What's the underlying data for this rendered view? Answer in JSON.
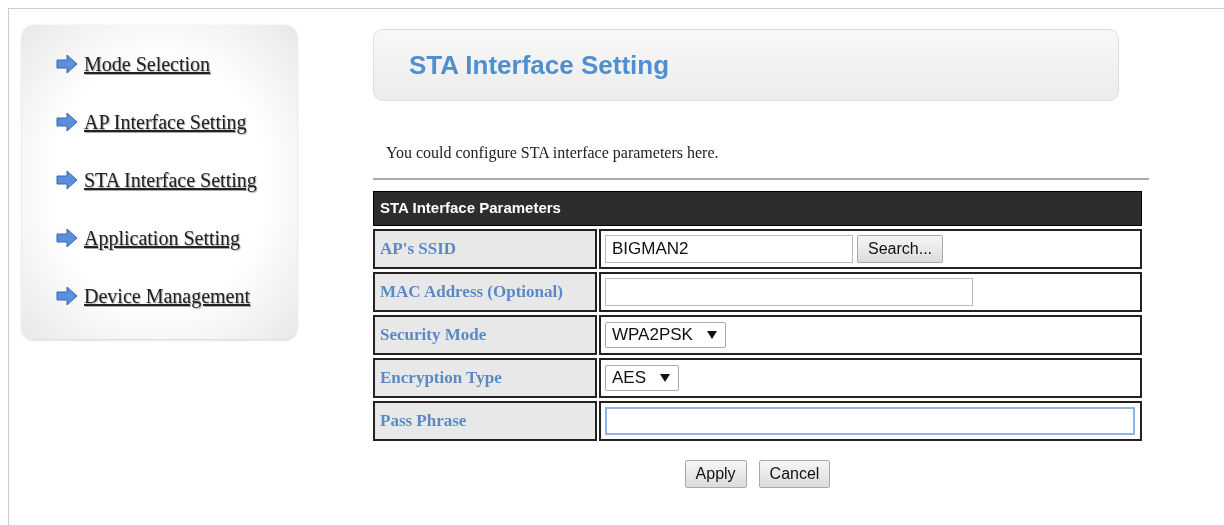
{
  "sidebar": {
    "items": [
      {
        "label": "Mode Selection"
      },
      {
        "label": "AP Interface Setting"
      },
      {
        "label": "STA Interface Setting"
      },
      {
        "label": "Application Setting"
      },
      {
        "label": "Device Management"
      }
    ]
  },
  "header": {
    "title": "STA Interface Setting"
  },
  "description": "You could configure STA interface parameters here.",
  "table": {
    "title": "STA Interface Parameters",
    "rows": [
      {
        "label": "AP's SSID",
        "kind": "text",
        "value": "BIGMAN2",
        "button": "Search...",
        "focused": false
      },
      {
        "label": "MAC Address (Optional)",
        "kind": "text",
        "focused": false
      },
      {
        "label": "Security Mode",
        "kind": "select",
        "value": "WPA2PSK",
        "focused": false
      },
      {
        "label": "Encryption Type",
        "kind": "select",
        "value": "AES",
        "focused": false
      },
      {
        "label": "Pass Phrase",
        "kind": "password",
        "focused": true
      }
    ]
  },
  "buttons": [
    "Apply",
    "Cancel"
  ]
}
